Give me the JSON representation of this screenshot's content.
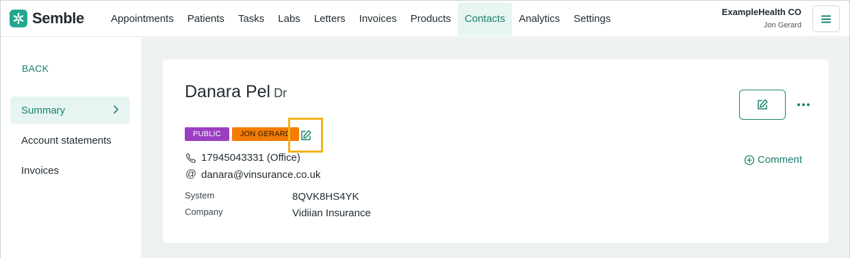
{
  "app": {
    "brand": "Semble"
  },
  "nav": {
    "items": [
      {
        "label": "Appointments",
        "active": false
      },
      {
        "label": "Patients",
        "active": false
      },
      {
        "label": "Tasks",
        "active": false
      },
      {
        "label": "Labs",
        "active": false
      },
      {
        "label": "Letters",
        "active": false
      },
      {
        "label": "Invoices",
        "active": false
      },
      {
        "label": "Products",
        "active": false
      },
      {
        "label": "Contacts",
        "active": true
      },
      {
        "label": "Analytics",
        "active": false
      },
      {
        "label": "Settings",
        "active": false
      }
    ]
  },
  "account": {
    "org": "ExampleHealth CO",
    "user": "Jon Gerard"
  },
  "sidebar": {
    "back_label": "BACK",
    "items": [
      {
        "label": "Summary",
        "active": true
      },
      {
        "label": "Account statements",
        "active": false
      },
      {
        "label": "Invoices",
        "active": false
      }
    ]
  },
  "contact": {
    "name": "Danara Pel",
    "title": "Dr",
    "tags": [
      "PUBLIC",
      "JON GERARD"
    ],
    "phone": "17945043331 (Office)",
    "email": "danara@vinsurance.co.uk",
    "fields": [
      {
        "label": "System",
        "value": "8QVK8HS4YK"
      },
      {
        "label": "Company",
        "value": "Vidiian Insurance"
      }
    ],
    "comment_label": "Comment"
  },
  "colors": {
    "accent": "#16806d",
    "brand": "#23a68f",
    "tag_public": "#9b3fc2",
    "tag_owner": "#f57c00",
    "highlight": "#f2b21b",
    "background": "#eef1f2"
  }
}
